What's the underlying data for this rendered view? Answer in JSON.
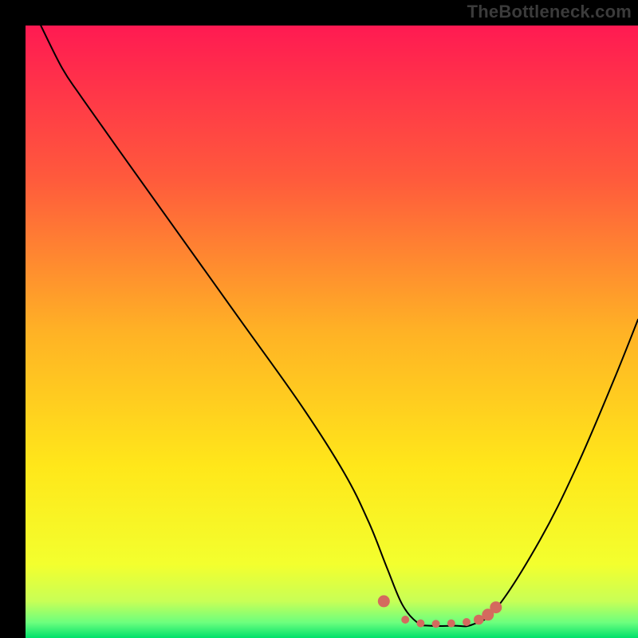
{
  "watermark": "TheBottleneck.com",
  "chart_data": {
    "type": "line",
    "title": "",
    "xlabel": "",
    "ylabel": "",
    "xlim": [
      0,
      100
    ],
    "ylim": [
      0,
      100
    ],
    "axes_visible": false,
    "grid": false,
    "background_gradient": {
      "stops": [
        {
          "offset": 0.0,
          "color": "#ff1a52"
        },
        {
          "offset": 0.25,
          "color": "#ff5a3c"
        },
        {
          "offset": 0.5,
          "color": "#ffb225"
        },
        {
          "offset": 0.72,
          "color": "#ffe71a"
        },
        {
          "offset": 0.88,
          "color": "#f3ff2e"
        },
        {
          "offset": 0.94,
          "color": "#c8ff56"
        },
        {
          "offset": 0.975,
          "color": "#6bff7e"
        },
        {
          "offset": 1.0,
          "color": "#00e06b"
        }
      ]
    },
    "series": [
      {
        "name": "bottleneck-curve",
        "color": "#000000",
        "stroke_width": 2,
        "x": [
          2.5,
          6,
          9,
          15,
          25,
          35,
          45,
          52,
          56,
          59,
          61.5,
          64,
          66,
          70,
          73,
          77,
          84,
          90,
          96,
          100
        ],
        "y": [
          100,
          93,
          88.5,
          80,
          66,
          52,
          38,
          27,
          19,
          11.5,
          5.5,
          2.5,
          2,
          2,
          2.2,
          5,
          16,
          28,
          42,
          52
        ]
      }
    ],
    "highlight": {
      "name": "optimal-range",
      "color": "#d46a5e",
      "points": [
        {
          "x": 58.5,
          "y": 6.0,
          "r": 6
        },
        {
          "x": 62.0,
          "y": 3.0,
          "r": 4
        },
        {
          "x": 64.5,
          "y": 2.4,
          "r": 4
        },
        {
          "x": 67.0,
          "y": 2.3,
          "r": 4
        },
        {
          "x": 69.5,
          "y": 2.4,
          "r": 4
        },
        {
          "x": 72.0,
          "y": 2.6,
          "r": 4
        },
        {
          "x": 74.0,
          "y": 3.0,
          "r": 5
        },
        {
          "x": 75.5,
          "y": 3.8,
          "r": 6
        },
        {
          "x": 76.8,
          "y": 5.0,
          "r": 6
        }
      ]
    }
  }
}
